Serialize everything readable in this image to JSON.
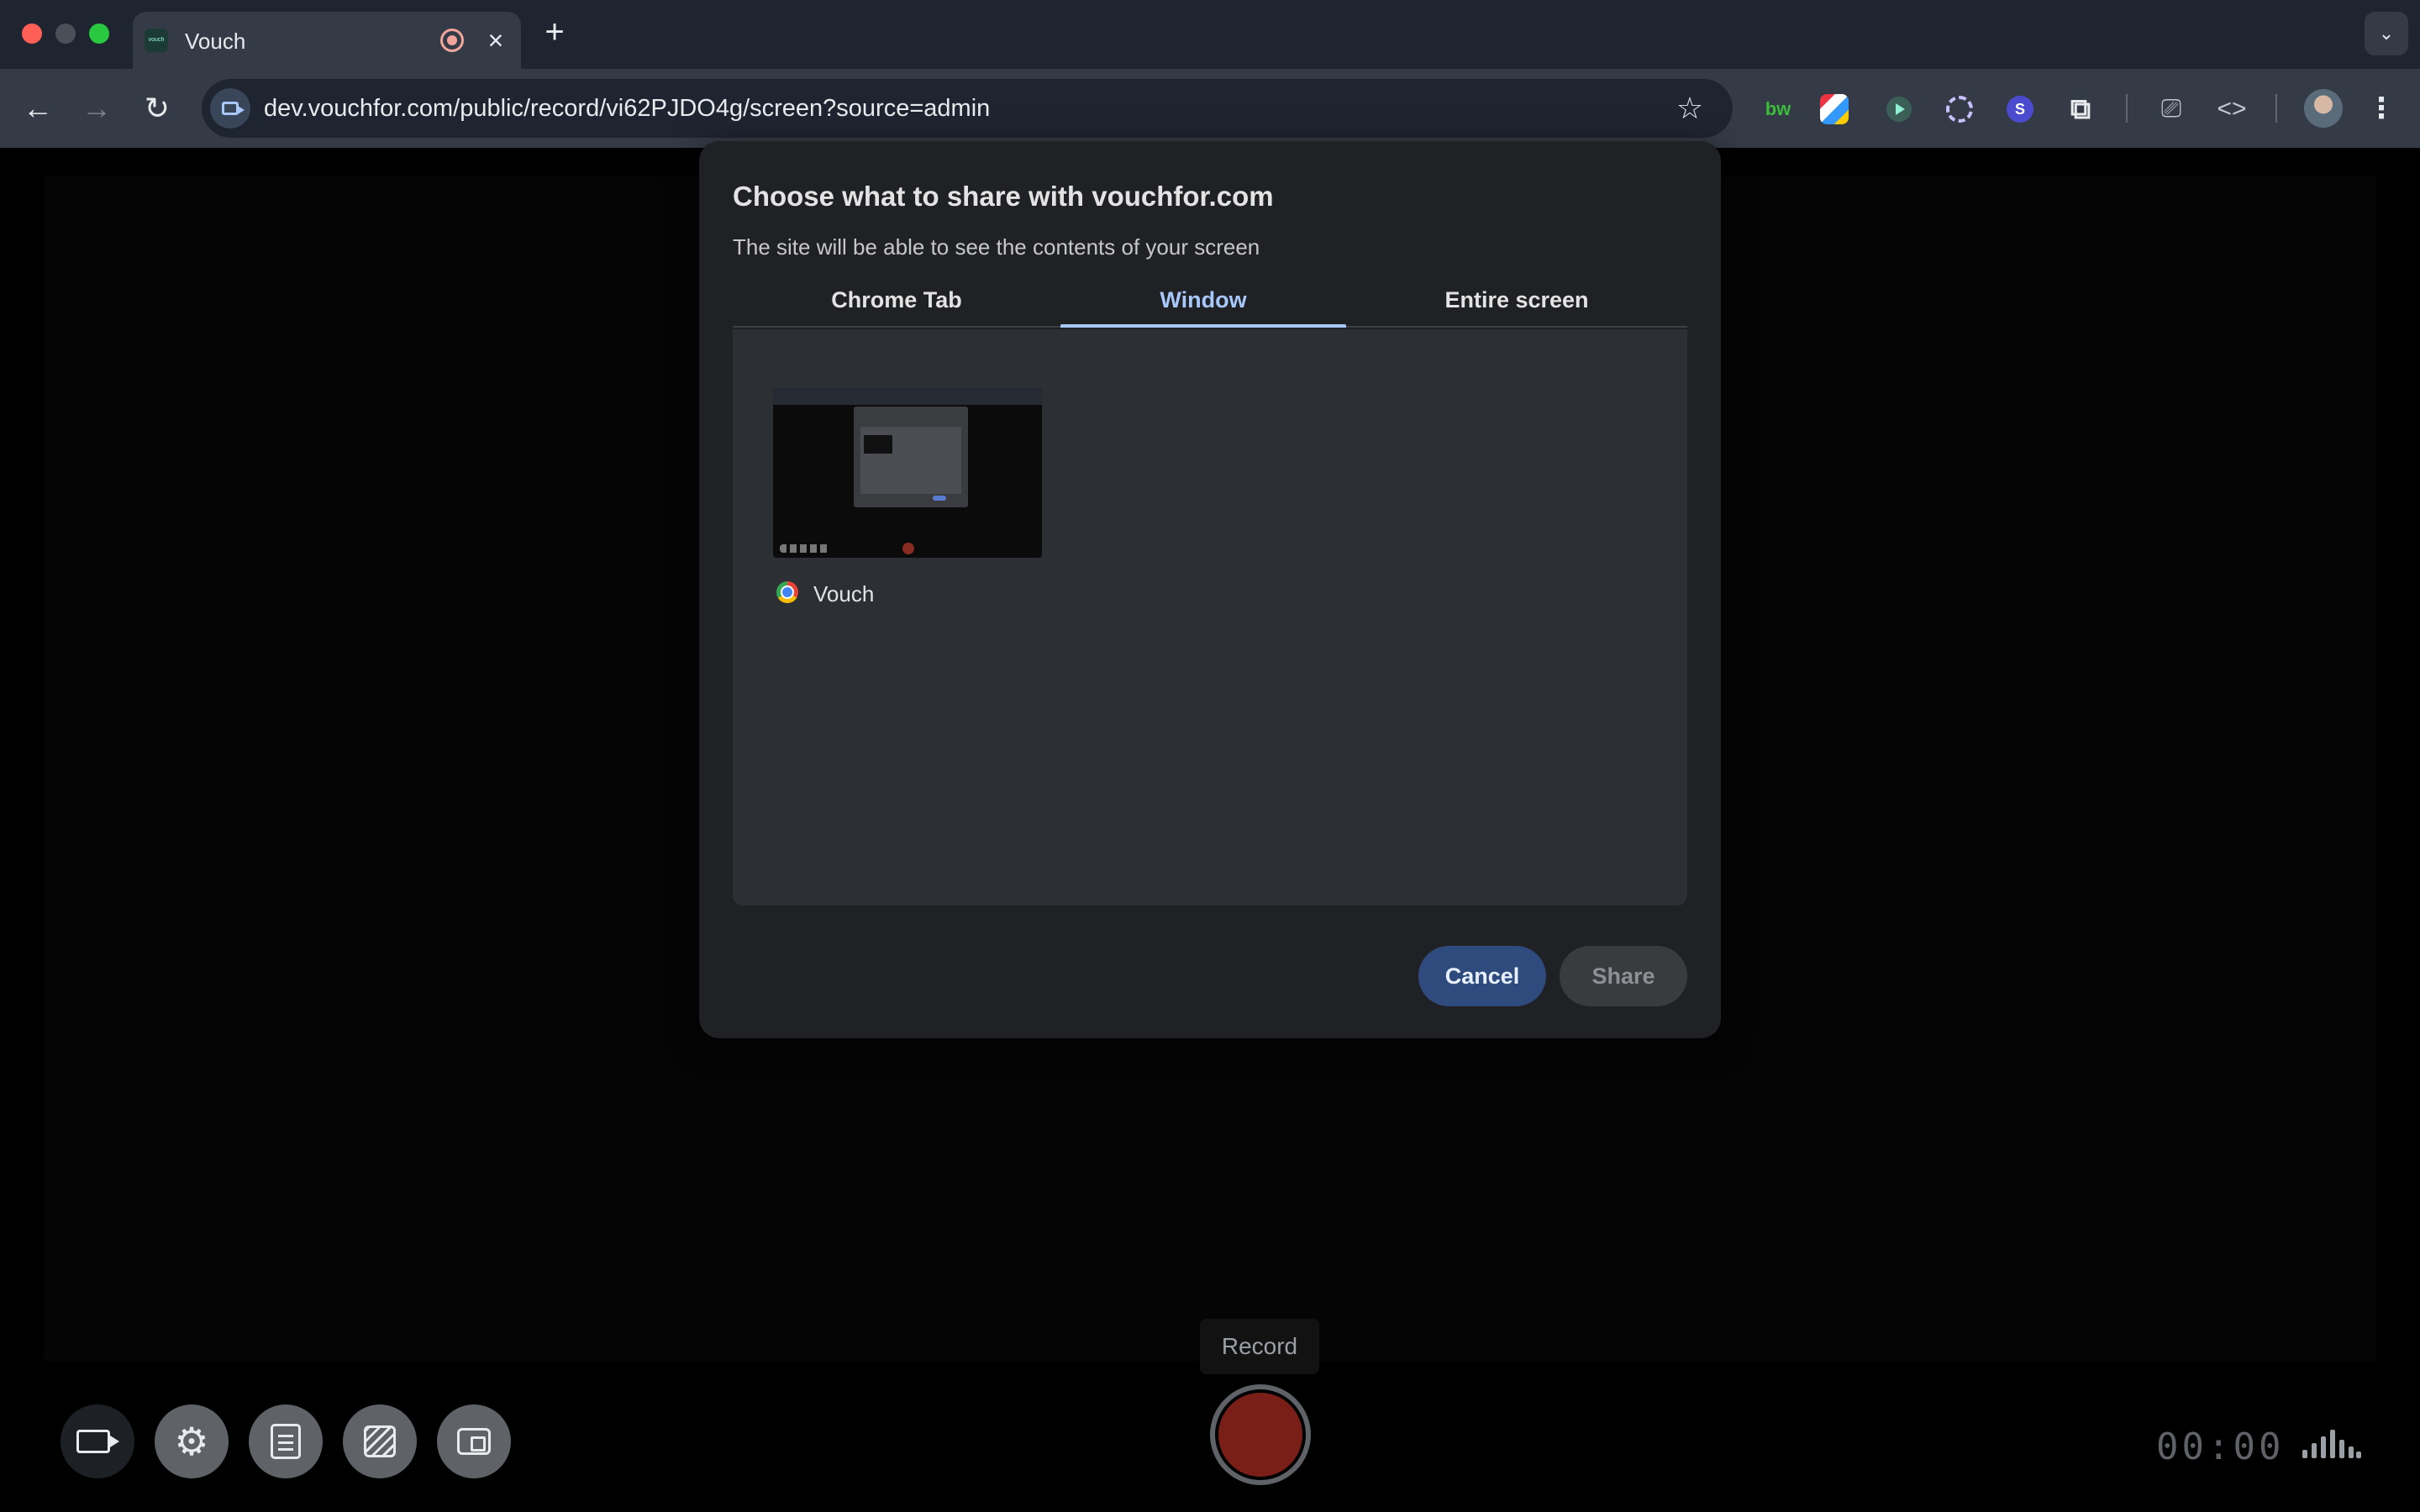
{
  "browser": {
    "tab": {
      "title": "Vouch",
      "favicon_text": "vouch"
    },
    "icons": {
      "back": "←",
      "forward": "→",
      "reload": "↻",
      "star": "☆",
      "close": "×",
      "new_tab": "+",
      "tab_search": "⌄",
      "puzzle": "⧉",
      "cast": "⎚",
      "devtools": "<>",
      "menu": "⋮"
    },
    "url": "dev.vouchfor.com/public/record/vi62PJDO4g/screen?source=admin",
    "extensions": {
      "bw": "bw",
      "s": "S"
    }
  },
  "dialog": {
    "title": "Choose what to share with vouchfor.com",
    "subtitle": "The site will be able to see the contents of your screen",
    "tabs": [
      {
        "label": "Chrome Tab"
      },
      {
        "label": "Window"
      },
      {
        "label": "Entire screen"
      }
    ],
    "active_tab": "Window",
    "sources": [
      {
        "label": "Vouch"
      }
    ],
    "cancel_label": "Cancel",
    "share_label": "Share"
  },
  "recorder": {
    "record_tooltip": "Record",
    "timer": "00:00",
    "gear_glyph": "⚙",
    "colors": {
      "record": "#7a1f17",
      "accent": "#a8c7fa",
      "cancel_bg": "#2f4b7e"
    }
  }
}
